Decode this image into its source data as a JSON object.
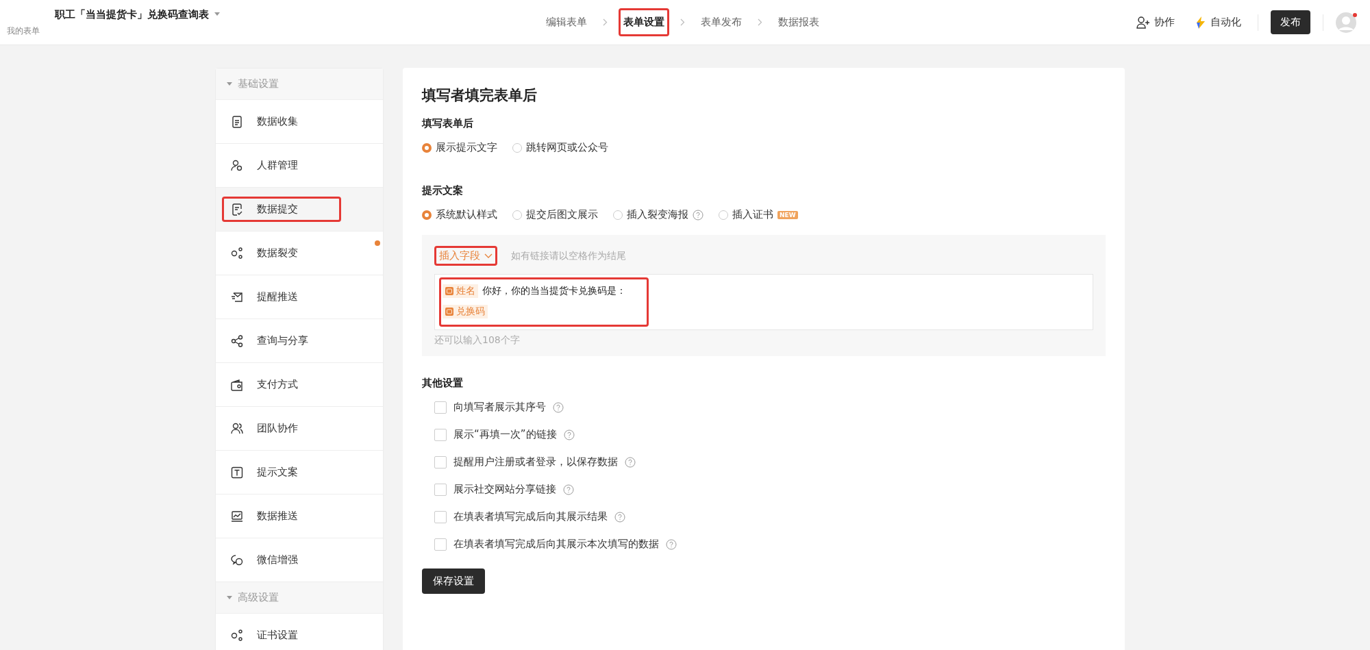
{
  "header": {
    "form_title": "职工「当当提货卡」兑换码查询表",
    "breadcrumb": "我的表单",
    "steps": [
      {
        "label": "编辑表单",
        "selected": false,
        "highlighted": false
      },
      {
        "label": "表单设置",
        "selected": true,
        "highlighted": true
      },
      {
        "label": "表单发布",
        "selected": false,
        "highlighted": false
      },
      {
        "label": "数据报表",
        "selected": false,
        "highlighted": false
      }
    ],
    "collaborate": "协作",
    "automation": "自动化",
    "publish": "发布",
    "avatar_notification": true
  },
  "sidebar": {
    "groups": [
      {
        "title": "基础设置",
        "expanded": true,
        "items": [
          {
            "label": "数据收集",
            "selected": false,
            "highlighted": false,
            "dot": false
          },
          {
            "label": "人群管理",
            "selected": false,
            "highlighted": false,
            "dot": false
          },
          {
            "label": "数据提交",
            "selected": true,
            "highlighted": true,
            "dot": false
          },
          {
            "label": "数据裂变",
            "selected": false,
            "highlighted": false,
            "dot": true
          },
          {
            "label": "提醒推送",
            "selected": false,
            "highlighted": false,
            "dot": false
          },
          {
            "label": "查询与分享",
            "selected": false,
            "highlighted": false,
            "dot": false
          },
          {
            "label": "支付方式",
            "selected": false,
            "highlighted": false,
            "dot": false
          },
          {
            "label": "团队协作",
            "selected": false,
            "highlighted": false,
            "dot": false
          },
          {
            "label": "提示文案",
            "selected": false,
            "highlighted": false,
            "dot": false
          },
          {
            "label": "数据推送",
            "selected": false,
            "highlighted": false,
            "dot": false
          },
          {
            "label": "微信增强",
            "selected": false,
            "highlighted": false,
            "dot": false
          }
        ]
      },
      {
        "title": "高级设置",
        "expanded": true,
        "items": [
          {
            "label": "证书设置",
            "selected": false,
            "highlighted": false,
            "dot": false
          }
        ]
      }
    ]
  },
  "main": {
    "title": "填写者填完表单后",
    "after_submit": {
      "label": "填写表单后",
      "options": [
        {
          "label": "展示提示文字",
          "selected": true
        },
        {
          "label": "跳转网页或公众号",
          "selected": false
        }
      ]
    },
    "prompt": {
      "label": "提示文案",
      "options": [
        {
          "label": "系统默认样式",
          "selected": true,
          "help": false
        },
        {
          "label": "提交后图文展示",
          "selected": false,
          "help": false
        },
        {
          "label": "插入裂变海报",
          "selected": false,
          "help": true
        },
        {
          "label": "插入证书",
          "selected": false,
          "help": false,
          "badge": "NEW"
        }
      ]
    },
    "editor": {
      "insert_field": "插入字段",
      "insert_highlighted": true,
      "hint": "如有链接请以空格作为结尾",
      "content_highlighted": true,
      "lines": [
        [
          {
            "kind": "field",
            "text": "姓名"
          },
          {
            "kind": "text",
            "text": "你好，你的当当提货卡兑换码是："
          }
        ],
        [
          {
            "kind": "field",
            "text": "兑换码"
          }
        ]
      ],
      "counter": "还可以输入108个字"
    },
    "other": {
      "label": "其他设置",
      "options": [
        {
          "label": "向填写者展示其序号",
          "checked": false
        },
        {
          "label": "展示“再填一次”的链接",
          "checked": false
        },
        {
          "label": "提醒用户注册或者登录，以保存数据",
          "checked": false
        },
        {
          "label": "展示社交网站分享链接",
          "checked": false
        },
        {
          "label": "在填表者填写完成后向其展示结果",
          "checked": false
        },
        {
          "label": "在填表者填写完成后向其展示本次填写的数据",
          "checked": false
        }
      ]
    },
    "save": "保存设置"
  }
}
